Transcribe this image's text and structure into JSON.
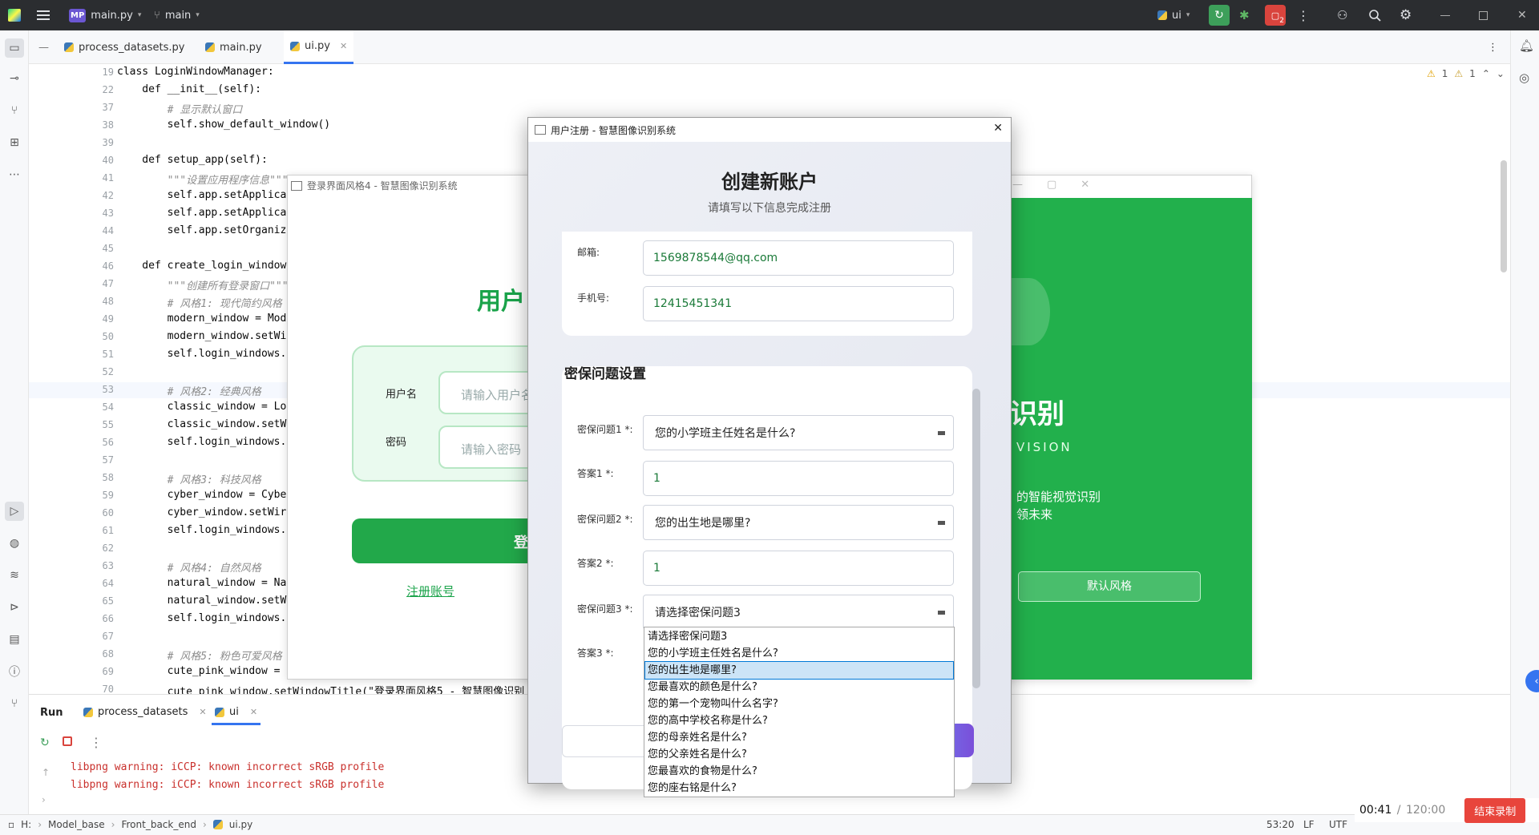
{
  "titlebar": {
    "project_badge": "MP",
    "project": "main.py",
    "branch": "main",
    "run_config": "ui",
    "badge_count": "2"
  },
  "tabs": [
    {
      "label": "process_datasets.py"
    },
    {
      "label": "main.py"
    },
    {
      "label": "ui.py"
    }
  ],
  "warnings": {
    "w1": "1",
    "w2": "1"
  },
  "editor": {
    "lines": [
      {
        "n": "19",
        "code": "class LoginWindowManager:"
      },
      {
        "n": "22",
        "code": "    def __init__(self):"
      },
      {
        "n": "37",
        "code": "        # 显示默认窗口"
      },
      {
        "n": "38",
        "code": "        self.show_default_window()"
      },
      {
        "n": "39",
        "code": ""
      },
      {
        "n": "40",
        "code": "    def setup_app(self):"
      },
      {
        "n": "41",
        "code": "        \"\"\"设置应用程序信息\"\"\""
      },
      {
        "n": "42",
        "code": "        self.app.setApplica"
      },
      {
        "n": "43",
        "code": "        self.app.setApplica"
      },
      {
        "n": "44",
        "code": "        self.app.setOrganiz"
      },
      {
        "n": "45",
        "code": ""
      },
      {
        "n": "46",
        "code": "    def create_login_window"
      },
      {
        "n": "47",
        "code": "        \"\"\"创建所有登录窗口\"\"\""
      },
      {
        "n": "48",
        "code": "        # 风格1: 现代简约风格"
      },
      {
        "n": "49",
        "code": "        modern_window = Mod"
      },
      {
        "n": "50",
        "code": "        modern_window.setWi"
      },
      {
        "n": "51",
        "code": "        self.login_windows."
      },
      {
        "n": "52",
        "code": ""
      },
      {
        "n": "53",
        "code": "        # 风格2: 经典风格"
      },
      {
        "n": "54",
        "code": "        classic_window = Lo"
      },
      {
        "n": "55",
        "code": "        classic_window.setW"
      },
      {
        "n": "56",
        "code": "        self.login_windows."
      },
      {
        "n": "57",
        "code": ""
      },
      {
        "n": "58",
        "code": "        # 风格3: 科技风格"
      },
      {
        "n": "59",
        "code": "        cyber_window = Cybe"
      },
      {
        "n": "60",
        "code": "        cyber_window.setWir"
      },
      {
        "n": "61",
        "code": "        self.login_windows."
      },
      {
        "n": "62",
        "code": ""
      },
      {
        "n": "63",
        "code": "        # 风格4: 自然风格"
      },
      {
        "n": "64",
        "code": "        natural_window = Na"
      },
      {
        "n": "65",
        "code": "        natural_window.setW"
      },
      {
        "n": "66",
        "code": "        self.login_windows."
      },
      {
        "n": "67",
        "code": ""
      },
      {
        "n": "68",
        "code": "        # 风格5: 粉色可爱风格"
      },
      {
        "n": "69",
        "code": "        cute_pink_window = "
      },
      {
        "n": "70",
        "code": "        cute_pink_window.setWindowTitle(\"登录界面风格5 - 智慧图像识别"
      }
    ]
  },
  "run": {
    "title": "Run",
    "tabs": [
      {
        "label": "process_datasets"
      },
      {
        "label": "ui"
      }
    ],
    "output": [
      "libpng warning: iCCP: known incorrect sRGB profile",
      "libpng warning: iCCP: known incorrect sRGB profile"
    ]
  },
  "status": {
    "path": [
      "H:",
      "Model_base",
      "Front_back_end",
      "ui.py"
    ],
    "position": "53:20",
    "line_ending": "LF",
    "encoding": "UTF"
  },
  "recording": {
    "elapsed": "00:41",
    "sep": " / ",
    "total": "120:00",
    "stop": "结束录制"
  },
  "login": {
    "title": "登录界面风格4 - 智慧图像识别系统",
    "heading": "用户",
    "username_label": "用户名",
    "username_placeholder": "请输入用户名",
    "password_label": "密码",
    "password_placeholder": "请输入密码",
    "login_button": "登",
    "register_link": "注册账号",
    "brand_big": "识别",
    "brand_sub": "VISION",
    "slogan1": "的智能视觉识别",
    "slogan2": "领未来",
    "default_style_button": "默认风格"
  },
  "dialog": {
    "title": "用户注册 - 智慧图像识别系统",
    "heading": "创建新账户",
    "subheading": "请填写以下信息完成注册",
    "email_label": "邮箱:",
    "email_value": "1569878544@qq.com",
    "phone_label": "手机号:",
    "phone_value": "12415451341",
    "section_title": "密保问题设置",
    "q1_label": "密保问题1 *:",
    "q1_value": "您的小学班主任姓名是什么?",
    "a1_label": "答案1 *:",
    "a1_value": "1",
    "q2_label": "密保问题2 *:",
    "q2_value": "您的出生地是哪里?",
    "a2_label": "答案2 *:",
    "a2_value": "1",
    "q3_label": "密保问题3 *:",
    "q3_value": "请选择密保问题3",
    "a3_label": "答案3 *:",
    "options": [
      "请选择密保问题3",
      "您的小学班主任姓名是什么?",
      "您的出生地是哪里?",
      "您最喜欢的颜色是什么?",
      "您的第一个宠物叫什么名字?",
      "您的高中学校名称是什么?",
      "您的母亲姓名是什么?",
      "您的父亲姓名是什么?",
      "您最喜欢的食物是什么?",
      "您的座右铭是什么?"
    ],
    "highlighted_index": 2
  },
  "colors": {
    "accent_green": "#22b04c",
    "stop_red": "#e8453c",
    "link_green": "#1aa34a"
  }
}
